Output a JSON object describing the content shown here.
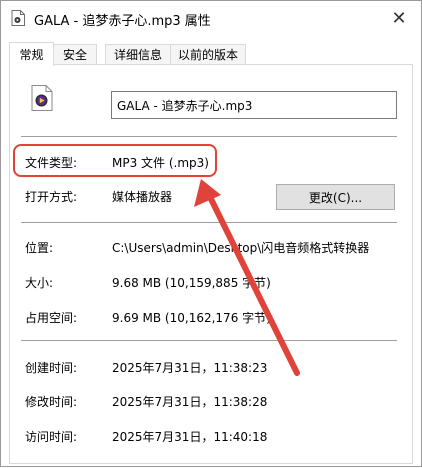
{
  "window": {
    "title": "GALA - 追梦赤子心.mp3 属性",
    "close_glyph": "✕"
  },
  "tabs": [
    {
      "label": "常规",
      "active": true
    },
    {
      "label": "安全",
      "active": false
    },
    {
      "label": "详细信息",
      "active": false
    },
    {
      "label": "以前的版本",
      "active": false
    }
  ],
  "general": {
    "file_name": "GALA - 追梦赤子心.mp3",
    "file_type_label": "文件类型:",
    "file_type_value": "MP3 文件 (.mp3)",
    "open_with_label": "打开方式:",
    "open_with_value": "媒体播放器",
    "change_button": "更改(C)...",
    "location_label": "位置:",
    "location_value": "C:\\Users\\admin\\Desktop\\闪电音频格式转换器",
    "size_label": "大小:",
    "size_value": "9.68 MB (10,159,885 字节)",
    "size_on_disk_label": "占用空间:",
    "size_on_disk_value": "9.69 MB (10,162,176 字节)",
    "created_label": "创建时间:",
    "created_value": "2025年7月31日，11:38:23",
    "modified_label": "修改时间:",
    "modified_value": "2025年7月31日，11:38:28",
    "accessed_label": "访问时间:",
    "accessed_value": "2025年7月31日，11:40:18"
  },
  "icons": {
    "title_icon": "document-icon",
    "file_icon": "media-file-icon",
    "close_icon": "close-icon"
  },
  "colors": {
    "annotation_red": "#e0433a",
    "media_purple": "#5b2d8e",
    "button_face": "#e1e1e1"
  }
}
